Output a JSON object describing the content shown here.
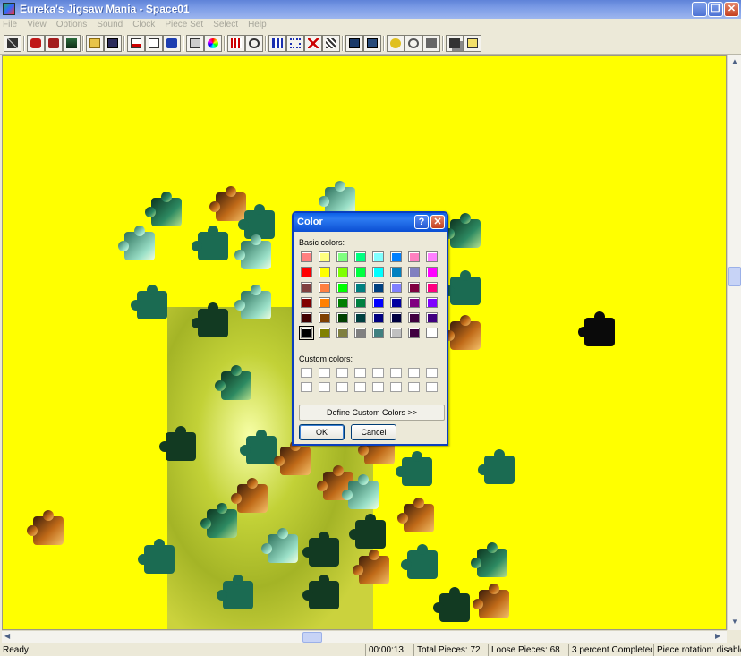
{
  "window": {
    "title": "Eureka's Jigsaw Mania - Space01",
    "min_glyph": "_",
    "max_glyph": "❐",
    "close_glyph": "✕"
  },
  "menu": [
    "File",
    "View",
    "Options",
    "Sound",
    "Clock",
    "Piece Set",
    "Select",
    "Help"
  ],
  "toolbar": {
    "icons": [
      "wand-icon",
      "puzzle-red-icon",
      "puzzle-icon",
      "image-icon",
      "open-folder-icon",
      "save-icon",
      "document-icon",
      "mail-icon",
      "info-icon",
      "palette-icon",
      "color-wheel-icon",
      "shuffle-icon",
      "clock-timer-icon",
      "grid-icon",
      "grid-select-icon",
      "delete-icon",
      "scatter-icon",
      "display-icon",
      "display-alt-icon",
      "music-icon",
      "sound-icon",
      "speaker-icon",
      "copy-icon",
      "help-icon"
    ]
  },
  "canvas": {
    "background_color": "#ffff00"
  },
  "color_dialog": {
    "title": "Color",
    "help_glyph": "?",
    "close_glyph": "✕",
    "basic_colors_label": "Basic colors:",
    "custom_colors_label": "Custom colors:",
    "define_button": "Define Custom Colors >>",
    "ok_button": "OK",
    "cancel_button": "Cancel",
    "selected_color": "#000000",
    "basic_colors": [
      "#ff8080",
      "#ffff80",
      "#80ff80",
      "#00ff80",
      "#80ffff",
      "#0080ff",
      "#ff80c0",
      "#ff80ff",
      "#ff0000",
      "#ffff00",
      "#80ff00",
      "#00ff40",
      "#00ffff",
      "#0080c0",
      "#8080c0",
      "#ff00ff",
      "#804040",
      "#ff8040",
      "#00ff00",
      "#008080",
      "#004080",
      "#8080ff",
      "#800040",
      "#ff0080",
      "#800000",
      "#ff8000",
      "#008000",
      "#008040",
      "#0000ff",
      "#0000a0",
      "#800080",
      "#8000ff",
      "#400000",
      "#804000",
      "#004000",
      "#004040",
      "#000080",
      "#000040",
      "#400040",
      "#400080",
      "#000000",
      "#808000",
      "#808040",
      "#808080",
      "#408080",
      "#c0c0c0",
      "#400040",
      "#ffffff"
    ]
  },
  "statusbar": {
    "ready": "Ready",
    "time": "00:00:13",
    "total_pieces": "Total Pieces: 72",
    "loose_pieces": "Loose Pieces: 68",
    "completed": "3 percent Completed",
    "rotation": "Piece rotation: disabled"
  }
}
